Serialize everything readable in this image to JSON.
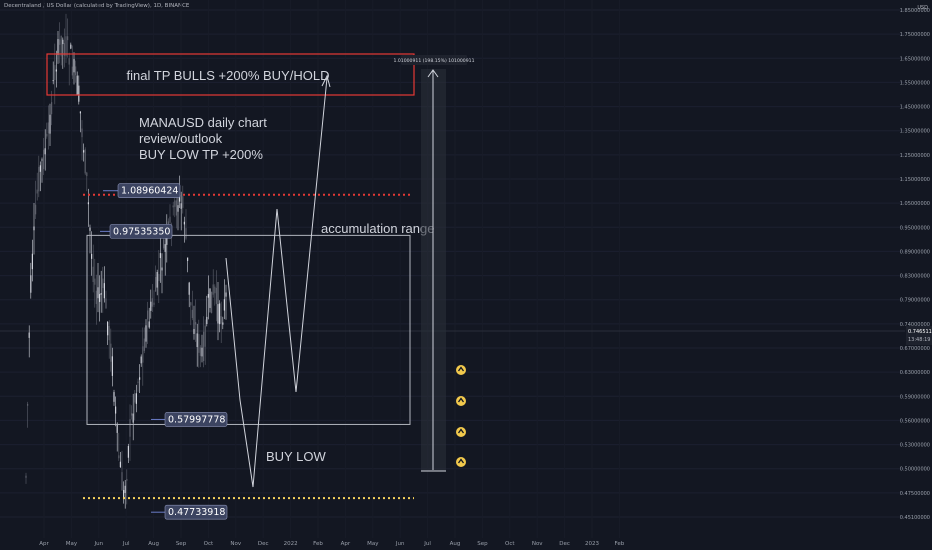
{
  "header": {
    "symbol_description": "Decentraland / US Dollar (calculated by TradingView), 1D, BINANCE",
    "currency": "USD"
  },
  "chart_data": {
    "type": "candlestick",
    "symbol": "MANAUSD",
    "interval": "1D",
    "exchange": "BINANCE",
    "price_axis_labels": [
      "1.85000000",
      "1.75000000",
      "1.65000000",
      "1.55000000",
      "1.45000000",
      "1.35000000",
      "1.25000000",
      "1.15000000",
      "1.05000000",
      "0.95000000",
      "0.89000000",
      "0.83000000",
      "0.79000000",
      "0.74000000",
      "0.67000000",
      "0.63000000",
      "0.59000000",
      "0.56000000",
      "0.53000000",
      "0.50000000",
      "0.47500000",
      "0.45100000"
    ],
    "time_axis_labels": [
      "Apr",
      "May",
      "Jun",
      "Jul",
      "Aug",
      "Sep",
      "Oct",
      "Nov",
      "Dec",
      "2022",
      "Feb",
      "Apr",
      "May",
      "Jun",
      "Jul",
      "Aug",
      "Sep",
      "Oct",
      "Nov",
      "Dec",
      "2023",
      "Feb"
    ],
    "current_price": "0.74651193",
    "countdown": "13:48:19",
    "levels": [
      {
        "label": "1.08960424",
        "value": 1.08960424,
        "style": "dotted",
        "color": "#e53935"
      },
      {
        "label": "0.97535350",
        "value": 0.9753535,
        "style": "box-top",
        "color": "#b2b5be"
      },
      {
        "label": "0.57997778",
        "value": 0.57997778,
        "style": "box-bottom",
        "color": "#b2b5be"
      },
      {
        "label": "0.47733918",
        "value": 0.47733918,
        "style": "dotted",
        "color": "#f9d45c"
      }
    ],
    "projection_label": "1.01000911 (198.15%) 101000911",
    "annotations": {
      "title_lines": [
        "MANAUSD daily chart",
        "review/outlook",
        "BUY LOW TP +200%"
      ],
      "target_zone": "final TP BULLS +200% BUY/HOLD",
      "range": "accumulation range",
      "buy": "BUY LOW"
    },
    "colors": {
      "background": "#131722",
      "candles": "#d1d4dc",
      "target_box": "#e53935",
      "annotation_text": "#d1d4dc",
      "label_bg": "#3c4461",
      "price_tag_bg": "#1e222d"
    }
  }
}
